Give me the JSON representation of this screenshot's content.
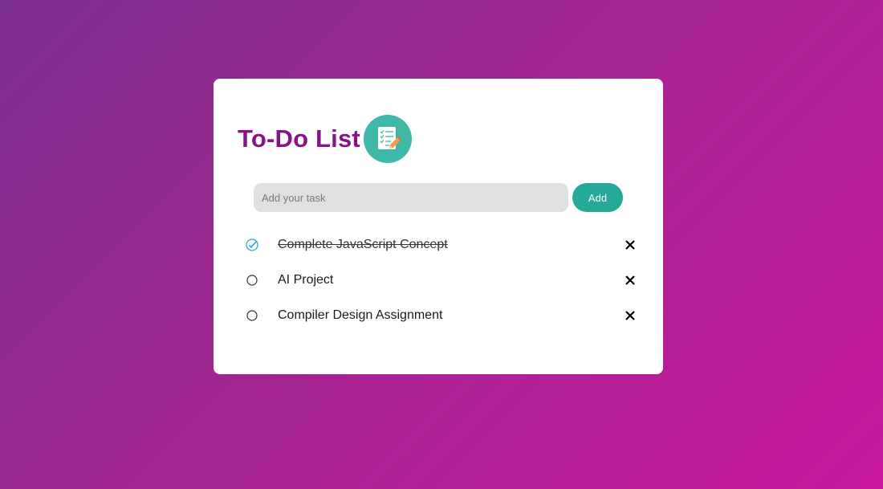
{
  "app": {
    "title": "To-Do List",
    "logo_icon": "checklist-pencil-icon"
  },
  "input": {
    "placeholder": "Add your task",
    "value": "",
    "button_label": "Add"
  },
  "colors": {
    "title": "#8a1289",
    "accent": "#26a996",
    "logo_bg": "#3fb8a8",
    "checked": "#2ba6de"
  },
  "tasks": [
    {
      "text": "Complete JavaScript Concept",
      "done": true,
      "check_icon": "checked-circle-icon",
      "delete_icon": "close-icon"
    },
    {
      "text": "AI Project",
      "done": false,
      "check_icon": "empty-circle-icon",
      "delete_icon": "close-icon"
    },
    {
      "text": "Compiler Design Assignment",
      "done": false,
      "check_icon": "empty-circle-icon",
      "delete_icon": "close-icon"
    }
  ]
}
